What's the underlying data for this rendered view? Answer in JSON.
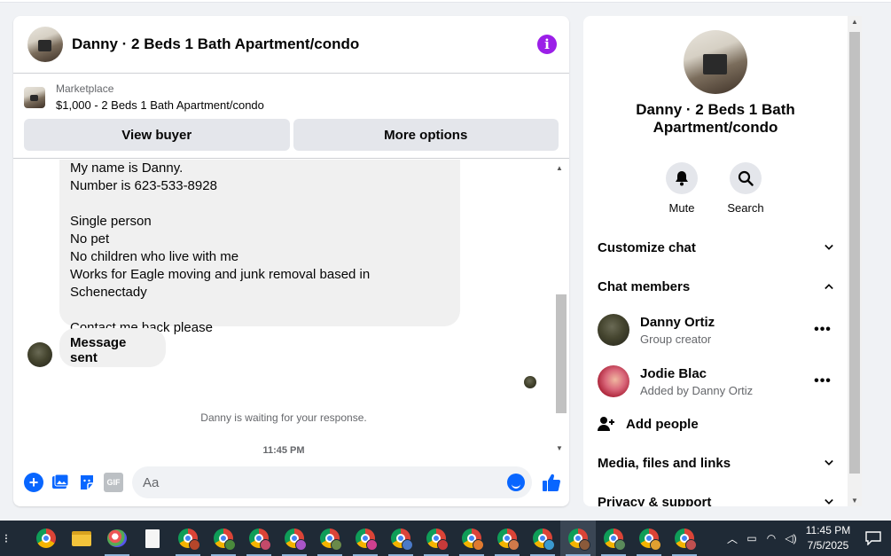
{
  "chat": {
    "title": "Danny · 2 Beds 1 Bath Apartment/condo",
    "marketplace": {
      "label": "Marketplace",
      "item": "$1,000 - 2 Beds 1 Bath Apartment/condo",
      "view_buyer": "View buyer",
      "more_options": "More options"
    },
    "message_lines": [
      "My name is Danny.",
      "Number is 623-533-8928",
      "",
      "Single person",
      "No pet",
      "No children who live with me",
      "Works for Eagle moving and junk removal based in Schenectady",
      "",
      "Contact me back please"
    ],
    "message_sent": "Message sent",
    "waiting_text": "Danny is waiting for your response.",
    "timestamp": "11:45 PM",
    "composer_placeholder": "Aa"
  },
  "side": {
    "title": "Danny · 2 Beds 1 Bath Apartment/condo",
    "mute_label": "Mute",
    "search_label": "Search",
    "customize_chat": "Customize chat",
    "chat_members": "Chat members",
    "members": [
      {
        "name": "Danny Ortiz",
        "sub": "Group creator"
      },
      {
        "name": "Jodie Blac",
        "sub": "Added by Danny Ortiz"
      }
    ],
    "add_people": "Add people",
    "media_files_links": "Media, files and links",
    "privacy_support": "Privacy & support"
  },
  "taskbar": {
    "time": "11:45 PM",
    "date": "7/5/2025"
  },
  "colors": {
    "accent": "#0866ff",
    "info": "#9b1fe8",
    "bubble": "#f0f0f0",
    "taskbar": "#1f2a36"
  }
}
